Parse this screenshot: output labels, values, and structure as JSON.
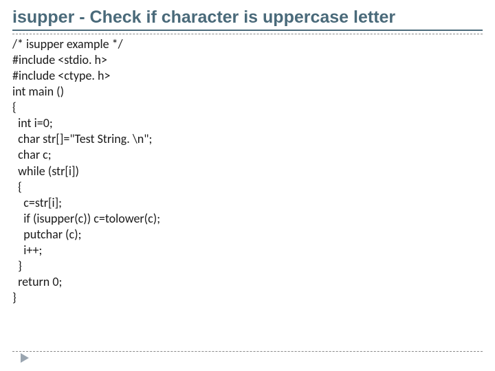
{
  "title": "isupper - Check if character is uppercase letter",
  "code": "/* isupper example */\n#include <stdio. h>\n#include <ctype. h>\nint main ()\n{\n  int i=0;\n  char str[]=\"Test String. \\n\";\n  char c;\n  while (str[i])\n  {\n    c=str[i];\n    if (isupper(c)) c=tolower(c);\n    putchar (c);\n    i++;\n  }\n  return 0;\n}",
  "arrow_icon": "arrow-right"
}
